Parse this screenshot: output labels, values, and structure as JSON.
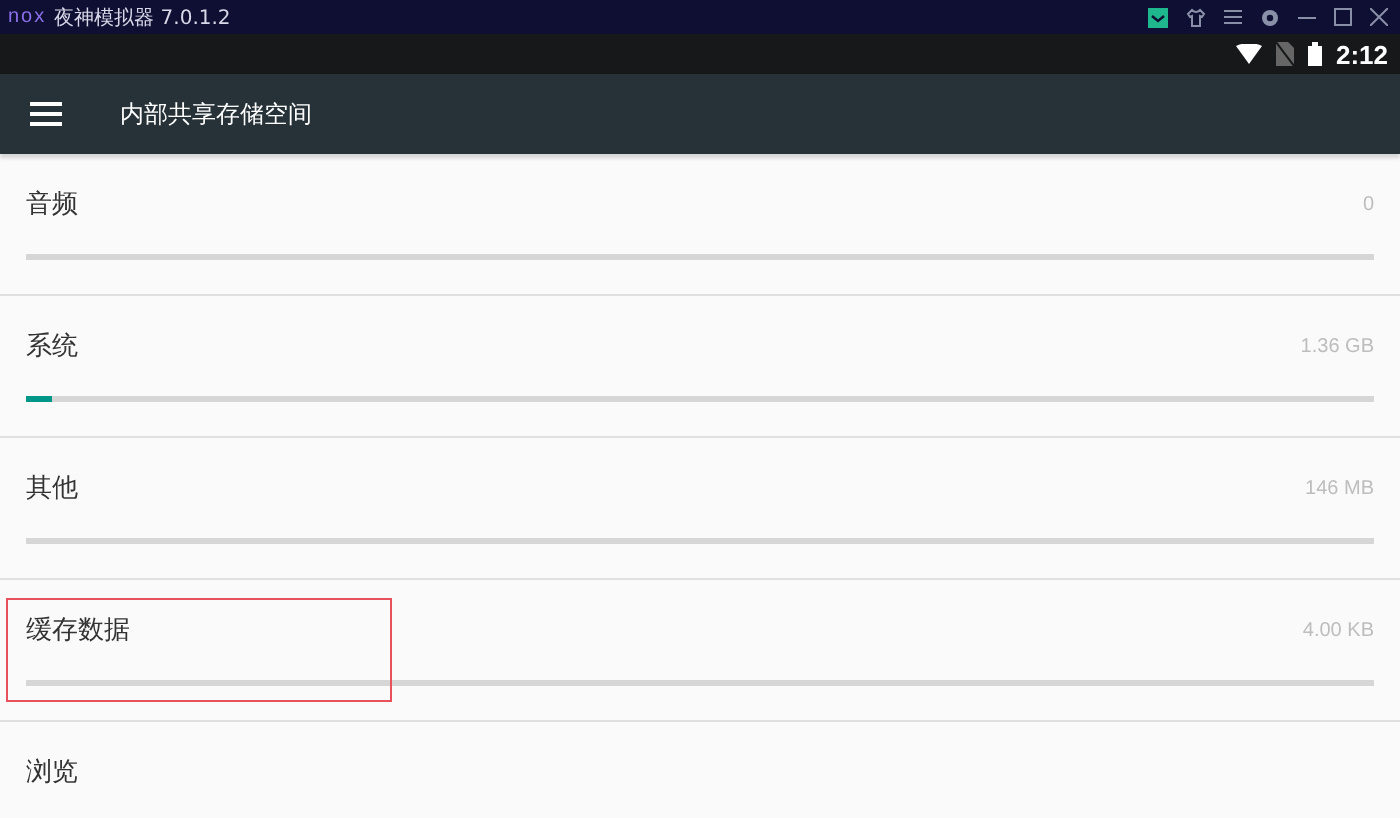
{
  "window": {
    "logo": "nox",
    "title": "夜神模拟器 7.0.1.2"
  },
  "status_bar": {
    "time": "2:12"
  },
  "app_bar": {
    "title": "内部共享存储空间"
  },
  "items": [
    {
      "label": "音频",
      "value": "0",
      "level": 0,
      "highlighted": false
    },
    {
      "label": "系统",
      "value": "1.36 GB",
      "level": 0.02,
      "highlighted": false
    },
    {
      "label": "其他",
      "value": "146 MB",
      "level": 0,
      "highlighted": false
    },
    {
      "label": "缓存数据",
      "value": "4.00 KB",
      "level": 0,
      "highlighted": true
    },
    {
      "label": "浏览",
      "highlighted": false
    }
  ]
}
